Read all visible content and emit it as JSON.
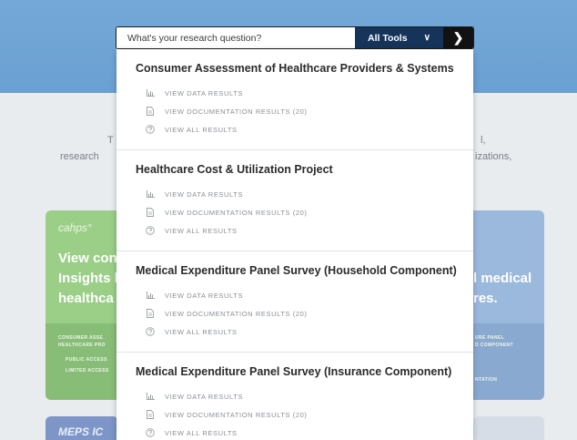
{
  "search": {
    "placeholder": "What's your research question?",
    "tool_label": "All Tools",
    "tool_chevron": "∨",
    "go_glyph": "❯"
  },
  "background": {
    "line1_left": "T",
    "line1_right": "l,",
    "line2_left": "research",
    "line2_right": "izations,",
    "green_card": {
      "logo": "cahps°",
      "title_lines": [
        "View con",
        "Insights l",
        "healthca"
      ],
      "foot_lines": [
        "CONSUMER ASSE",
        "HEALTHCARE PRO",
        "PUBLIC ACCESS",
        "LIMITED ACCESS"
      ]
    },
    "blue_card": {
      "title_lines": [
        "l medical",
        "res."
      ],
      "foot_lines": [
        "URE PANEL",
        "D COMPONENT",
        "NTATION"
      ]
    },
    "bottom_left_logo": "MEPS IC"
  },
  "dropdown": {
    "groups": [
      {
        "title": "Consumer Assessment of Healthcare Providers & Systems",
        "links": [
          "VIEW DATA RESULTS",
          "VIEW DOCUMENTATION RESULTS (20)",
          "VIEW ALL RESULTS"
        ]
      },
      {
        "title": "Healthcare Cost & Utilization Project",
        "links": [
          "VIEW DATA RESULTS",
          "VIEW DOCUMENTATION RESULTS (20)",
          "VIEW ALL RESULTS"
        ]
      },
      {
        "title": "Medical Expenditure Panel Survey (Household Component)",
        "links": [
          "VIEW DATA RESULTS",
          "VIEW DOCUMENTATION RESULTS (20)",
          "VIEW ALL RESULTS"
        ]
      },
      {
        "title": "Medical Expenditure Panel Survey (Insurance Component)",
        "links": [
          "VIEW DATA RESULTS",
          "VIEW DOCUMENTATION RESULTS (20)",
          "VIEW ALL RESULTS"
        ]
      }
    ],
    "link_icons": [
      "bar-chart-icon",
      "document-icon",
      "help-circle-icon"
    ]
  },
  "colors": {
    "hero": "#6fa5d6",
    "tools_bg": "#16345a",
    "go_bg": "#121212",
    "green_card": "#9bcf88",
    "blue_card": "#9bb9dd"
  }
}
